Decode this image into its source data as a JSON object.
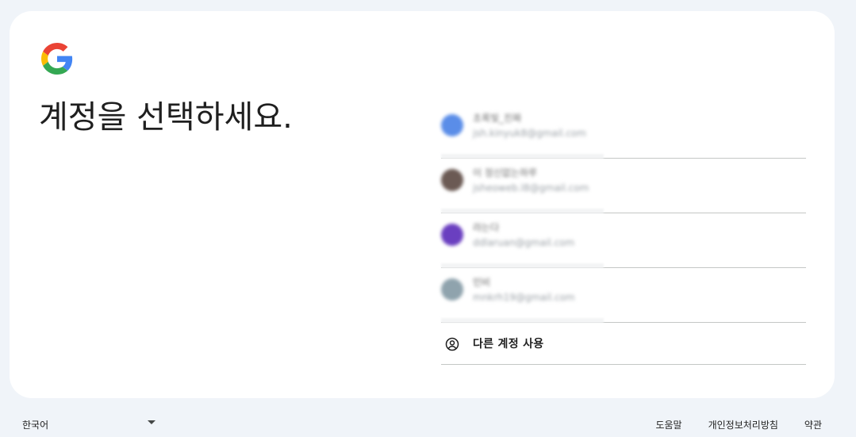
{
  "page": {
    "title": "계정을 선택하세요."
  },
  "accounts": [
    {
      "name": "초록빛_진짜",
      "email": "jsh.kinyuk8@gmail.com",
      "avatar_color": "#5a8de8"
    },
    {
      "name": "이 정신없는하루",
      "email": "jsheoweb.l8@gmail.com",
      "avatar_color": "#6b5a54"
    },
    {
      "name": "라는다",
      "email": "ddlaruan@gmail.com",
      "avatar_color": "#6a3fc0"
    },
    {
      "name": "민비",
      "email": "mnkrh19@gmail.com",
      "avatar_color": "#8fa3ad"
    }
  ],
  "other_account": {
    "label": "다른 계정 사용",
    "icon": "account-circle-icon"
  },
  "footer": {
    "language": "한국어",
    "links": [
      "도움말",
      "개인정보처리방침",
      "약관"
    ]
  },
  "colors": {
    "background": "#f0f4f9",
    "card": "#ffffff",
    "divider": "#c4c7c5",
    "text": "#1f1f1f"
  }
}
